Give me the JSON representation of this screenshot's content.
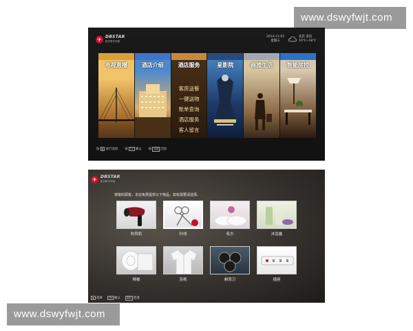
{
  "watermark": {
    "top": "www.dswyfwjt.com",
    "bottom": "www.dswyfwjt.com"
  },
  "logo": {
    "brand": "DBSTAR",
    "subtitle": "航天数字传媒"
  },
  "screen1": {
    "date": "2014-11-05",
    "weekday": "星期三",
    "weather_city": "北京",
    "weather_desc": "多云",
    "weather_temp": "10℃~18℃",
    "tiles": [
      {
        "label": "电视直播"
      },
      {
        "label": "酒店介绍"
      },
      {
        "label": "酒店服务"
      },
      {
        "label": "星影院"
      },
      {
        "label": "商旅生活"
      },
      {
        "label": "智能房控"
      }
    ],
    "service_menu": [
      "客房送餐",
      "一键送物",
      "账单查询",
      "酒店服务",
      "客人留言"
    ],
    "hints": [
      {
        "prefix": "按",
        "key": "◆",
        "text": "进行选择"
      },
      {
        "prefix": "按",
        "key": "OK",
        "text": "确认"
      },
      {
        "prefix": "按",
        "key": "返回",
        "text": "回退"
      }
    ]
  },
  "screen2": {
    "prompt": "尊敬的顾客，本店免费提供以下物品，如有需要请选择。",
    "items": [
      {
        "label": "吹风机",
        "icon": "hair-dryer-icon"
      },
      {
        "label": "针线",
        "icon": "needle-thread-icon"
      },
      {
        "label": "毛巾",
        "icon": "towel-icon"
      },
      {
        "label": "沐浴露",
        "icon": "shower-gel-icon"
      },
      {
        "label": "棉被",
        "icon": "quilt-icon"
      },
      {
        "label": "浴袍",
        "icon": "bathrobe-icon"
      },
      {
        "label": "剃须刀",
        "icon": "razor-icon"
      },
      {
        "label": "插座",
        "icon": "socket-icon"
      }
    ],
    "hints": [
      {
        "key": "◆",
        "text": "选择"
      },
      {
        "key": "OK",
        "text": "确认"
      },
      {
        "key": "返回",
        "text": "回退"
      }
    ]
  },
  "colors": {
    "accent": "#c8102e",
    "menu_text": "#f0d8a8"
  }
}
